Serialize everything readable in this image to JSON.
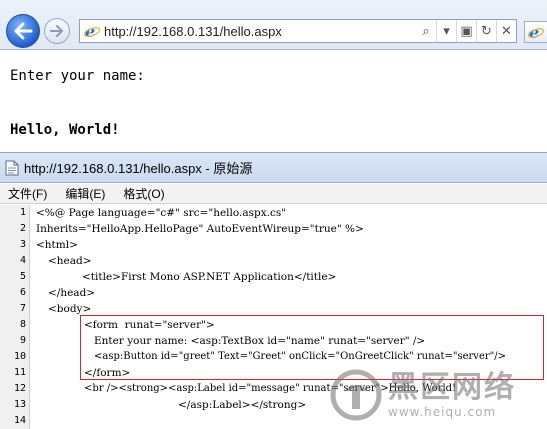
{
  "browser": {
    "address": "http://192.168.0.131/hello.aspx",
    "address_buttons": [
      "⌕",
      "▾",
      "▣",
      "↻",
      "✕"
    ]
  },
  "page": {
    "prompt": "Enter your name:",
    "greeting": "Hello, World!"
  },
  "source_window": {
    "title": "http://192.168.0.131/hello.aspx - 原始源",
    "menu": [
      "文件(F)",
      "编辑(E)",
      "格式(O)"
    ],
    "lines": [
      {
        "num": "1",
        "text": "<%@ Page language=\"c#\" src=\"hello.aspx.cs\""
      },
      {
        "num": "2",
        "text": "Inherits=\"HelloApp.HelloPage\" AutoEventWireup=\"true\" %>"
      },
      {
        "num": "3",
        "text": "<html>"
      },
      {
        "num": "4",
        "text": "<head>"
      },
      {
        "num": "5",
        "text": "<title>First Mono ASP.NET Application</title>"
      },
      {
        "num": "6",
        "text": "</head>"
      },
      {
        "num": "7",
        "text": "<body>"
      },
      {
        "num": "8",
        "text": "<form  runat=\"server\">"
      },
      {
        "num": "9",
        "text": "Enter your name: <asp:TextBox id=\"name\" runat=\"server\" />"
      },
      {
        "num": "10",
        "text": "<asp:Button id=\"greet\" Text=\"Greet\" onClick=\"OnGreetClick\" runat=\"server\"/>"
      },
      {
        "num": "11",
        "text": "</form>"
      },
      {
        "num": "12",
        "text": "<br /><strong><asp:Label id=\"message\" runat=\"server\">Hello, World!"
      },
      {
        "num": "13",
        "text": "</asp:Label></strong>"
      },
      {
        "num": "14",
        "text": ""
      }
    ]
  },
  "watermark": {
    "name": "黑区网络",
    "url": "www.heiqu.com"
  },
  "colors": {
    "highlight_border": "#d0282e",
    "ie_blue": "#1e6fd6",
    "toolbar": "#dfe8f4"
  }
}
